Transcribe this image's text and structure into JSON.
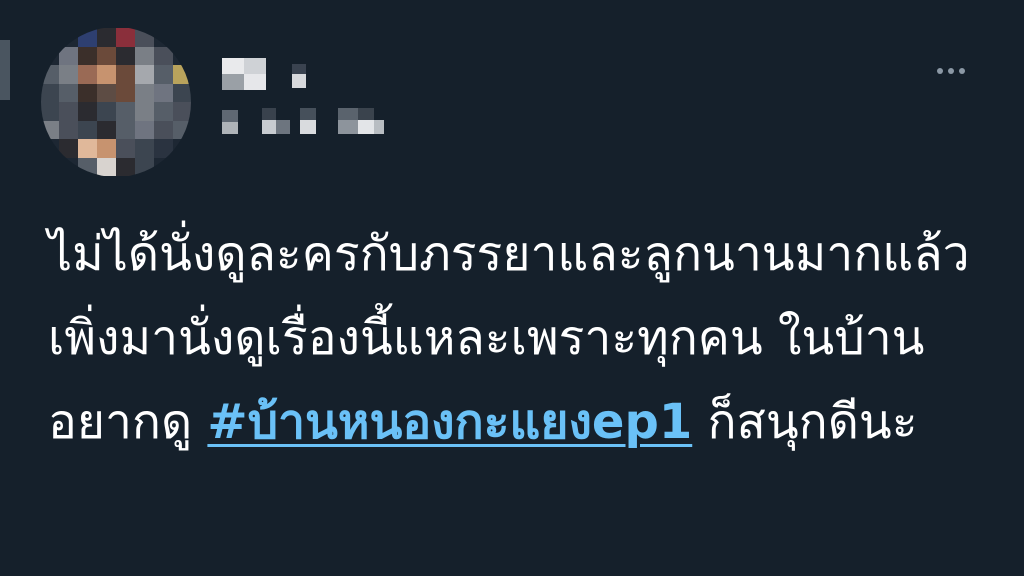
{
  "tweet": {
    "text_before": "ไม่ได้นั่งดูละครกับภรรยาและลูกนานมากแล้ว เพิ่งมานั่งดูเรื่องนี้แหละเพราะทุกคน ในบ้านอยากดู ",
    "hashtag": "#บ้านหนองกะแยงep1",
    "text_after": " ก็สนุกดีนะ"
  },
  "colors": {
    "background": "#15202b",
    "text": "#ffffff",
    "link": "#6ac1f7",
    "muted": "#8b98a5"
  },
  "icons": {
    "more": "more-horizontal-icon"
  }
}
